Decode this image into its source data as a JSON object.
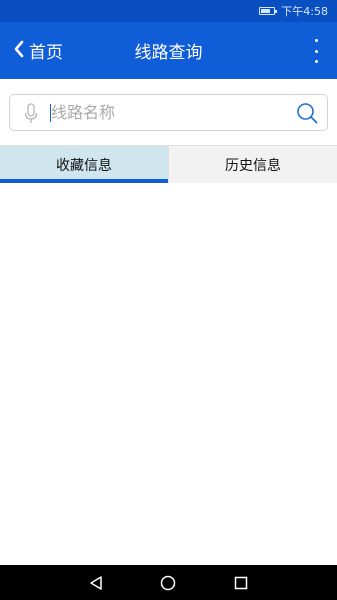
{
  "status_bar": {
    "time": "下午4:58"
  },
  "app_bar": {
    "back_label": "首页",
    "title": "线路查询"
  },
  "search": {
    "value": "",
    "placeholder": "线路名称"
  },
  "tabs": [
    {
      "label": "收藏信息",
      "active": true
    },
    {
      "label": "历史信息",
      "active": false
    }
  ],
  "colors": {
    "status_bar": "#0a4fc2",
    "app_bar": "#0f5dd7",
    "active_tab": "#d0e6ef",
    "indicator": "#0f5dd7"
  },
  "icons": {
    "back": "chevron-left-icon",
    "more": "more-vertical-icon",
    "mic": "microphone-icon",
    "search": "search-icon",
    "nav_back": "triangle-back-icon",
    "nav_home": "circle-home-icon",
    "nav_recents": "square-recents-icon"
  }
}
